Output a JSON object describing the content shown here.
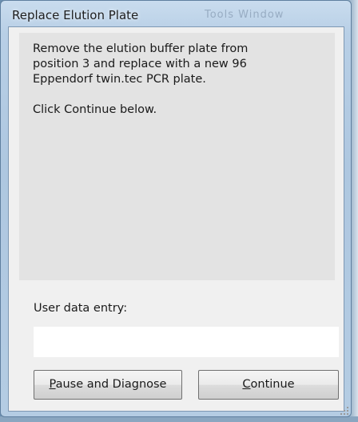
{
  "window": {
    "title": "Replace Elution Plate",
    "background_title_ghost": "Tools   Window"
  },
  "message": {
    "lines": [
      "Remove the elution buffer plate from",
      "position 3 and replace with a new 96",
      "Eppendorf twin.tec PCR  plate.",
      "",
      "Click Continue below."
    ]
  },
  "entry": {
    "label": "User data entry:",
    "value": "",
    "placeholder": ""
  },
  "buttons": {
    "pause": {
      "mnemonic": "P",
      "rest": "ause and Diagnose"
    },
    "continue": {
      "mnemonic": "C",
      "rest": "ontinue"
    }
  },
  "colors": {
    "frame": "#aec7e0",
    "client": "#f0f0f0",
    "message_bg": "#e3e3e3",
    "input_bg": "#ffffff"
  }
}
